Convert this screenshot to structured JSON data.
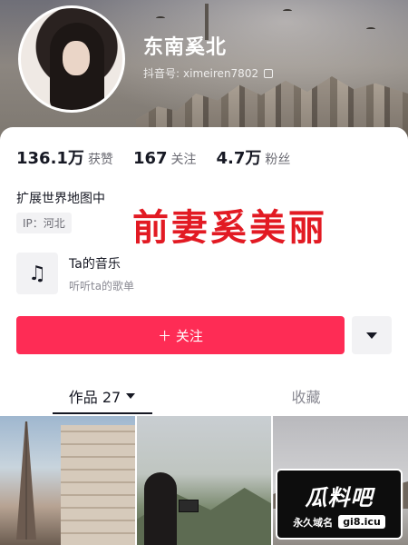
{
  "profile": {
    "name": "东南奚北",
    "douyin_id_label": "抖音号:",
    "douyin_id": "ximeiren7802"
  },
  "stats": {
    "likes_value": "136.1万",
    "likes_label": "获赞",
    "following_value": "167",
    "following_label": "关注",
    "followers_value": "4.7万",
    "followers_label": "粉丝"
  },
  "bio": {
    "text": "扩展世界地图中",
    "ip": "IP：河北"
  },
  "overlay": {
    "title": "前妻奚美丽"
  },
  "music": {
    "icon": "music-note-icon",
    "title": "Ta的音乐",
    "subtitle": "听听ta的歌单"
  },
  "actions": {
    "follow_label": "＋ 关注"
  },
  "tabs": {
    "works_label": "作品 27",
    "favorites_label": "收藏"
  },
  "watermark": {
    "logo_text": "瓜料吧",
    "sub_text": "永久域名",
    "domain": "gi8.icu"
  },
  "colors": {
    "accent": "#fe2c55",
    "overlay_red": "#e21a23"
  }
}
